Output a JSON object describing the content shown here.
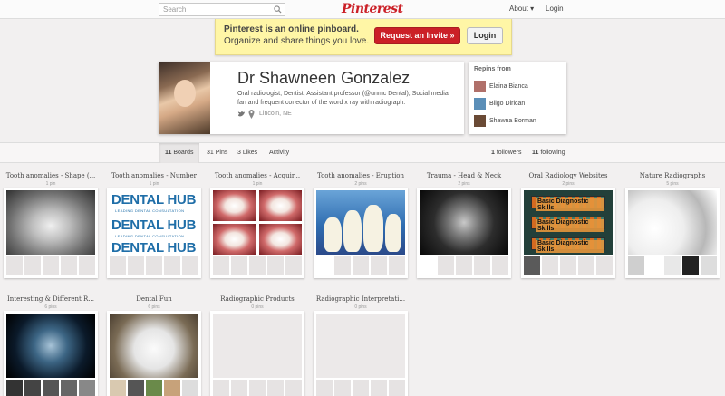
{
  "topbar": {
    "search_placeholder": "Search",
    "logo": "Pinterest",
    "about": "About ▾",
    "login": "Login"
  },
  "banner": {
    "title": "Pinterest is an online pinboard.",
    "subtitle": "Organize and share things you love.",
    "invite_label": "Request an Invite »",
    "login_label": "Login"
  },
  "profile": {
    "name": "Dr Shawneen Gonzalez",
    "bio": "Oral radiologist, Dentist, Assistant professor (@unmc Dental), Social media fan and frequent conector of the word x ray with radiograph.",
    "location": "Lincoln, NE"
  },
  "repins": {
    "title": "Repins from",
    "users": [
      {
        "name": "Elaina Bianca",
        "color": "#b0706a"
      },
      {
        "name": "Bilgo Dirican",
        "color": "#5b8fb8"
      },
      {
        "name": "Shawna Borman",
        "color": "#6a4a35"
      }
    ]
  },
  "tabs": {
    "boards_count": "11",
    "boards_label": "Boards",
    "pins": "31 Pins",
    "likes": "3 Likes",
    "activity": "Activity",
    "followers_count": "1",
    "followers_label": "followers",
    "following_count": "11",
    "following_label": "following"
  },
  "boards": [
    {
      "title": "Tooth anomalies - Shape (...",
      "count": "1 pin"
    },
    {
      "title": "Tooth anomalies - Number",
      "count": "1 pin"
    },
    {
      "title": "Tooth anomalies - Acquir...",
      "count": "1 pin"
    },
    {
      "title": "Tooth anomalies - Eruption",
      "count": "2 pins"
    },
    {
      "title": "Trauma - Head & Neck",
      "count": "2 pins"
    },
    {
      "title": "Oral Radiology Websites",
      "count": "2 pins"
    },
    {
      "title": "Nature Radiographs",
      "count": "5 pins"
    },
    {
      "title": "Interesting & Different R...",
      "count": "6 pins"
    },
    {
      "title": "Dental Fun",
      "count": "6 pins"
    },
    {
      "title": "Radiographic Products",
      "count": "0 pins"
    },
    {
      "title": "Radiographic Interpretati...",
      "count": "0 pins"
    }
  ],
  "dental_hub": {
    "line1": "DENTAL HUB",
    "line2": "LEADING DENTAL CONSULTATION"
  },
  "oral_site_label": "Basic Diagnostic Skills",
  "colors": {
    "accent": "#cb2027",
    "banner": "#fff6a6",
    "page_bg": "#f2f0f0"
  }
}
